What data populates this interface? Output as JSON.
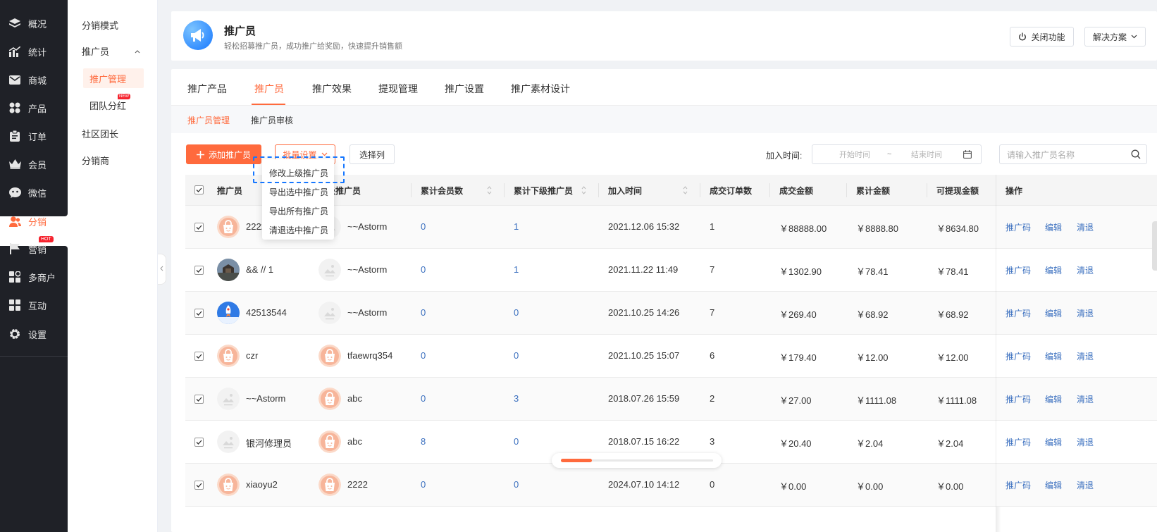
{
  "main_nav": {
    "items": [
      {
        "label": "概况",
        "icon": "layers-icon"
      },
      {
        "label": "统计",
        "icon": "bar-chart-icon"
      },
      {
        "label": "商城",
        "icon": "mail-icon"
      },
      {
        "label": "产品",
        "icon": "apps-icon"
      },
      {
        "label": "订单",
        "icon": "clipboard-icon"
      },
      {
        "label": "会员",
        "icon": "crown-icon"
      },
      {
        "label": "微信",
        "icon": "wechat-icon"
      },
      {
        "label": "分销",
        "icon": "users-icon",
        "active": true
      },
      {
        "label": "营销",
        "icon": "flag-icon",
        "badge": "HOT"
      },
      {
        "label": "多商户",
        "icon": "store-icon"
      },
      {
        "label": "互动",
        "icon": "grid-icon"
      },
      {
        "label": "设置",
        "icon": "gear-icon"
      }
    ]
  },
  "sub_nav": {
    "items": [
      "分销模式",
      "推广员",
      "推广管理",
      "团队分红",
      "社区团长",
      "分销商"
    ],
    "new_badge": "NEW"
  },
  "header": {
    "title": "推广员",
    "subtitle": "轻松招募推广员，成功推广给奖励，快速提升销售额",
    "close_label": "关闭功能",
    "solution_label": "解决方案"
  },
  "tabs": [
    "推广产品",
    "推广员",
    "推广效果",
    "提现管理",
    "推广设置",
    "推广素材设计"
  ],
  "subtabs": [
    "推广员管理",
    "推广员审核"
  ],
  "toolbar": {
    "add_label": "添加推广员",
    "batch_label": "批量设置",
    "columns_label": "选择列",
    "date_label": "加入时间:",
    "start_placeholder": "开始时间",
    "date_sep": "~",
    "end_placeholder": "结束时间",
    "search_placeholder": "请输入推广员名称"
  },
  "dropdown": [
    "修改上级推广员",
    "导出选中推广员",
    "导出所有推广员",
    "清退选中推广员"
  ],
  "table": {
    "headers": [
      "推广员",
      "上级推广员",
      "累计会员数",
      "累计下级推广员",
      "加入时间",
      "成交订单数",
      "成交金额",
      "累计金额",
      "可提现金额",
      "操作"
    ],
    "actions": [
      "推广码",
      "编辑",
      "清退"
    ],
    "rows": [
      {
        "name": "2222",
        "avatar": "bag",
        "parent": "~~Astorm",
        "parent_avatar": "placeholder",
        "members": "0",
        "subs": "1",
        "date": "2021.12.06 15:32",
        "orders": "1",
        "amount": "￥88888.00",
        "total": "￥8888.80",
        "withdraw": "￥8634.80"
      },
      {
        "name": "&& // 1",
        "avatar": "photo",
        "parent": "~~Astorm",
        "parent_avatar": "placeholder",
        "members": "0",
        "subs": "1",
        "date": "2021.11.22 11:49",
        "orders": "7",
        "amount": "￥1302.90",
        "total": "￥78.41",
        "withdraw": "￥78.41"
      },
      {
        "name": "42513544",
        "avatar": "rocket",
        "parent": "~~Astorm",
        "parent_avatar": "placeholder",
        "members": "0",
        "subs": "0",
        "date": "2021.10.25 14:26",
        "orders": "7",
        "amount": "￥269.40",
        "total": "￥68.92",
        "withdraw": "￥68.92"
      },
      {
        "name": "czr",
        "avatar": "bag",
        "parent": "tfaewrq354",
        "parent_avatar": "bag",
        "members": "0",
        "subs": "0",
        "date": "2021.10.25 15:07",
        "orders": "6",
        "amount": "￥179.40",
        "total": "￥12.00",
        "withdraw": "￥12.00"
      },
      {
        "name": "~~Astorm",
        "avatar": "placeholder",
        "parent": "abc",
        "parent_avatar": "bag",
        "members": "0",
        "subs": "3",
        "date": "2018.07.26 15:59",
        "orders": "2",
        "amount": "￥27.00",
        "total": "￥1111.08",
        "withdraw": "￥1111.08"
      },
      {
        "name": "银河修理员",
        "avatar": "placeholder",
        "parent": "abc",
        "parent_avatar": "bag",
        "members": "8",
        "subs": "0",
        "date": "2018.07.15 16:22",
        "orders": "3",
        "amount": "￥20.40",
        "total": "￥2.04",
        "withdraw": "￥2.04"
      },
      {
        "name": "xiaoyu2",
        "avatar": "bag",
        "parent": "2222",
        "parent_avatar": "bag",
        "members": "0",
        "subs": "0",
        "date": "2024.07.10 14:12",
        "orders": "0",
        "amount": "￥0.00",
        "total": "￥0.00",
        "withdraw": "￥0.00"
      }
    ]
  },
  "scroll": {
    "position_fraction": 0.2
  },
  "colors": {
    "accent": "#ff6a3d",
    "link": "#3a6fbf",
    "nav_bg": "#1f2127",
    "focus": "#1677ff"
  }
}
